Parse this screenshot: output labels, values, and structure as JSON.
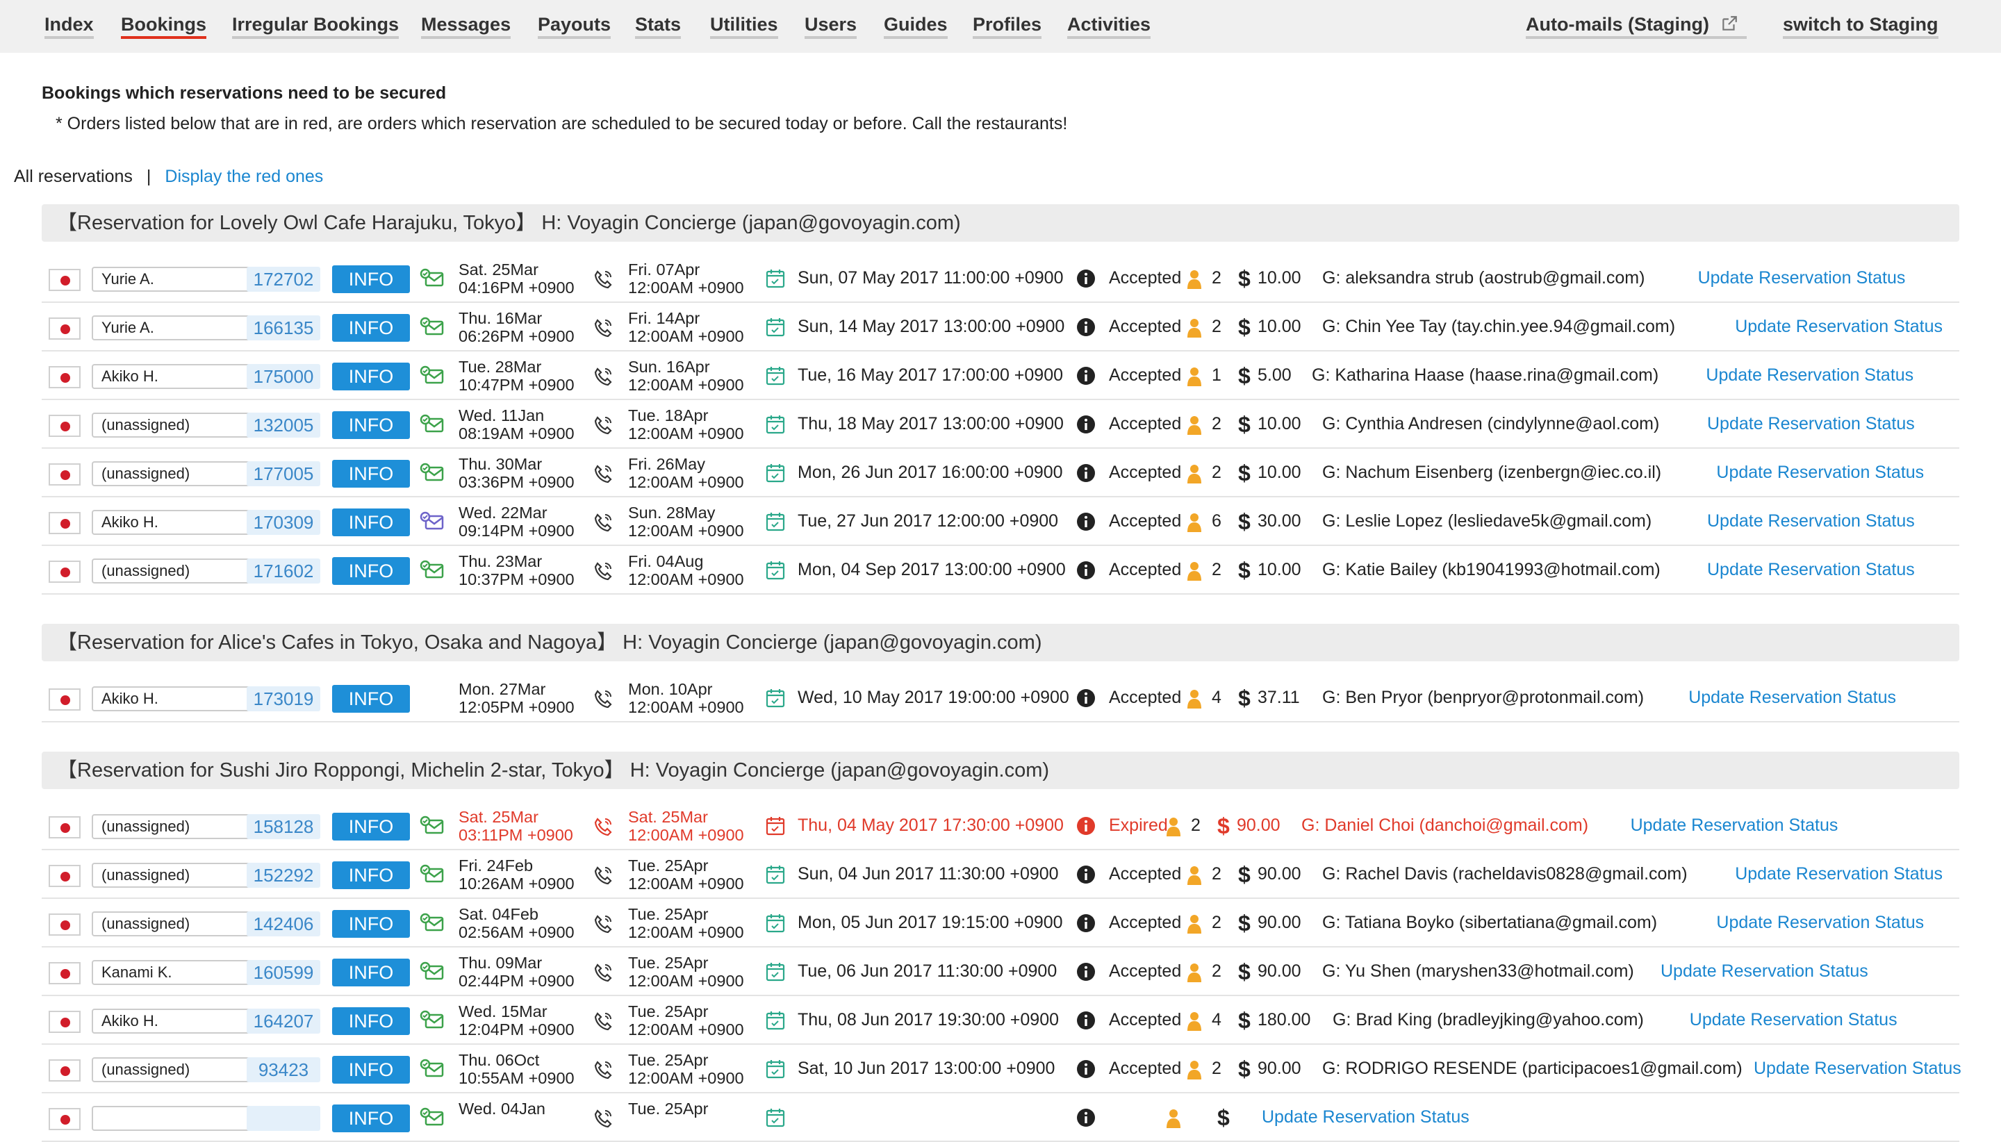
{
  "nav": {
    "items": [
      "Index",
      "Bookings",
      "Irregular Bookings",
      "Messages",
      "Payouts",
      "Stats",
      "Utilities",
      "Users",
      "Guides",
      "Profiles",
      "Activities"
    ],
    "active": "Bookings",
    "auto_mails": "Auto-mails (Staging)",
    "switch": "switch to Staging"
  },
  "page": {
    "title": "Bookings which reservations need to be secured",
    "note": "* Orders listed below that are in red, are orders which reservation are scheduled to be secured today or before. Call the restaurants!",
    "filter_all": "All reservations",
    "filter_sep": "|",
    "filter_red": "Display the red ones"
  },
  "icons": {
    "flag": "japan-flag-icon",
    "order": "order-email-icon",
    "phone": "phone-icon",
    "calendar": "calendar-icon",
    "info": "info-circle-icon",
    "person": "person-icon",
    "dollar": "dollar-icon",
    "external": "external-link-icon"
  },
  "colors": {
    "accent_link": "#1a86d0",
    "info_button": "#1e8fd8",
    "expired_red": "#e03a2a",
    "active_tab_underline": "#e0311d",
    "order_icon_green": "#3ca24a",
    "order_icon_purple": "#6d63c9",
    "person_orange": "#f2a627"
  },
  "labels": {
    "info": "INFO",
    "update": "Update Reservation Status",
    "dollar": "$"
  },
  "groups": [
    {
      "title": "【Reservation for Lovely Owl Cafe Harajuku, Tokyo】 H: Voyagin Concierge (japan@govoyagin.com)",
      "rows": [
        {
          "assignee": "Yurie A.",
          "id": "172702",
          "ordered_1": "Sat. 25Mar",
          "ordered_2": "04:16PM +0900",
          "secure_1": "Fri. 07Apr",
          "secure_2": "12:00AM +0900",
          "date": "Sun, 07 May 2017 11:00:00 +0900",
          "status": "Accepted",
          "pax": "2",
          "amount": "10.00",
          "guest": "G: aleksandra strub (aostrub@gmail.com)",
          "red": false,
          "order_icon": "green"
        },
        {
          "assignee": "Yurie A.",
          "id": "166135",
          "ordered_1": "Thu. 16Mar",
          "ordered_2": "06:26PM +0900",
          "secure_1": "Fri. 14Apr",
          "secure_2": "12:00AM +0900",
          "date": "Sun, 14 May 2017 13:00:00 +0900",
          "status": "Accepted",
          "pax": "2",
          "amount": "10.00",
          "guest": "G: Chin Yee Tay (tay.chin.yee.94@gmail.com)",
          "red": false,
          "order_icon": "green"
        },
        {
          "assignee": "Akiko H.",
          "id": "175000",
          "ordered_1": "Tue. 28Mar",
          "ordered_2": "10:47PM +0900",
          "secure_1": "Sun. 16Apr",
          "secure_2": "12:00AM +0900",
          "date": "Tue, 16 May 2017 17:00:00 +0900",
          "status": "Accepted",
          "pax": "1",
          "amount": "5.00",
          "guest": "G: Katharina Haase (haase.rina@gmail.com)",
          "red": false,
          "order_icon": "green"
        },
        {
          "assignee": "(unassigned)",
          "id": "132005",
          "ordered_1": "Wed. 11Jan",
          "ordered_2": "08:19AM +0900",
          "secure_1": "Tue. 18Apr",
          "secure_2": "12:00AM +0900",
          "date": "Thu, 18 May 2017 13:00:00 +0900",
          "status": "Accepted",
          "pax": "2",
          "amount": "10.00",
          "guest": "G: Cynthia Andresen (cindylynne@aol.com)",
          "red": false,
          "order_icon": "green"
        },
        {
          "assignee": "(unassigned)",
          "id": "177005",
          "ordered_1": "Thu. 30Mar",
          "ordered_2": "03:36PM +0900",
          "secure_1": "Fri. 26May",
          "secure_2": "12:00AM +0900",
          "date": "Mon, 26 Jun 2017 16:00:00 +0900",
          "status": "Accepted",
          "pax": "2",
          "amount": "10.00",
          "guest": "G: Nachum Eisenberg (izenbergn@iec.co.il)",
          "red": false,
          "order_icon": "green"
        },
        {
          "assignee": "Akiko H.",
          "id": "170309",
          "ordered_1": "Wed. 22Mar",
          "ordered_2": "09:14PM +0900",
          "secure_1": "Sun. 28May",
          "secure_2": "12:00AM +0900",
          "date": "Tue, 27 Jun 2017 12:00:00 +0900",
          "status": "Accepted",
          "pax": "6",
          "amount": "30.00",
          "guest": "G: Leslie Lopez (lesliedave5k@gmail.com)",
          "red": false,
          "order_icon": "purple"
        },
        {
          "assignee": "(unassigned)",
          "id": "171602",
          "ordered_1": "Thu. 23Mar",
          "ordered_2": "10:37PM +0900",
          "secure_1": "Fri. 04Aug",
          "secure_2": "12:00AM +0900",
          "date": "Mon, 04 Sep 2017 13:00:00 +0900",
          "status": "Accepted",
          "pax": "2",
          "amount": "10.00",
          "guest": "G: Katie Bailey (kb19041993@hotmail.com)",
          "red": false,
          "order_icon": "green"
        }
      ]
    },
    {
      "title": "【Reservation for Alice's Cafes in Tokyo, Osaka and Nagoya】 H: Voyagin Concierge (japan@govoyagin.com)",
      "rows": [
        {
          "assignee": "Akiko H.",
          "id": "173019",
          "ordered_1": "Mon. 27Mar",
          "ordered_2": "12:05PM +0900",
          "secure_1": "Mon. 10Apr",
          "secure_2": "12:00AM +0900",
          "date": "Wed, 10 May 2017 19:00:00 +0900",
          "status": "Accepted",
          "pax": "4",
          "amount": "37.11",
          "guest": "G: Ben Pryor (benpryor@protonmail.com)",
          "red": false,
          "order_icon": "none"
        }
      ]
    },
    {
      "title": "【Reservation for Sushi Jiro Roppongi, Michelin 2-star, Tokyo】 H: Voyagin Concierge (japan@govoyagin.com)",
      "rows": [
        {
          "assignee": "(unassigned)",
          "id": "158128",
          "ordered_1": "Sat. 25Mar",
          "ordered_2": "03:11PM +0900",
          "secure_1": "Sat. 25Mar",
          "secure_2": "12:00AM +0900",
          "date": "Thu, 04 May 2017 17:30:00 +0900",
          "status": "Expired",
          "pax": "2",
          "amount": "90.00",
          "guest": "G: Daniel Choi (danchoi@gmail.com)",
          "red": true,
          "order_icon": "green"
        },
        {
          "assignee": "(unassigned)",
          "id": "152292",
          "ordered_1": "Fri. 24Feb",
          "ordered_2": "10:26AM +0900",
          "secure_1": "Tue. 25Apr",
          "secure_2": "12:00AM +0900",
          "date": "Sun, 04 Jun 2017 11:30:00 +0900",
          "status": "Accepted",
          "pax": "2",
          "amount": "90.00",
          "guest": "G: Rachel Davis (racheldavis0828@gmail.com)",
          "red": false,
          "order_icon": "green"
        },
        {
          "assignee": "(unassigned)",
          "id": "142406",
          "ordered_1": "Sat. 04Feb",
          "ordered_2": "02:56AM +0900",
          "secure_1": "Tue. 25Apr",
          "secure_2": "12:00AM +0900",
          "date": "Mon, 05 Jun 2017 19:15:00 +0900",
          "status": "Accepted",
          "pax": "2",
          "amount": "90.00",
          "guest": "G: Tatiana Boyko (sibertatiana@gmail.com)",
          "red": false,
          "order_icon": "green"
        },
        {
          "assignee": "Kanami K.",
          "id": "160599",
          "ordered_1": "Thu. 09Mar",
          "ordered_2": "02:44PM +0900",
          "secure_1": "Tue. 25Apr",
          "secure_2": "12:00AM +0900",
          "date": "Tue, 06 Jun 2017 11:30:00 +0900",
          "status": "Accepted",
          "pax": "2",
          "amount": "90.00",
          "guest": "G: Yu Shen (maryshen33@hotmail.com)",
          "red": false,
          "order_icon": "green"
        },
        {
          "assignee": "Akiko H.",
          "id": "164207",
          "ordered_1": "Wed. 15Mar",
          "ordered_2": "12:04PM +0900",
          "secure_1": "Tue. 25Apr",
          "secure_2": "12:00AM +0900",
          "date": "Thu, 08 Jun 2017 19:30:00 +0900",
          "status": "Accepted",
          "pax": "4",
          "amount": "180.00",
          "guest": "G: Brad King (bradleyjking@yahoo.com)",
          "red": false,
          "order_icon": "green"
        },
        {
          "assignee": "(unassigned)",
          "id": "93423",
          "ordered_1": "Thu. 06Oct",
          "ordered_2": "10:55AM +0900",
          "secure_1": "Tue. 25Apr",
          "secure_2": "12:00AM +0900",
          "date": "Sat, 10 Jun 2017 13:00:00 +0900",
          "status": "Accepted",
          "pax": "2",
          "amount": "90.00",
          "guest": "G: RODRIGO RESENDE (participacoes1@gmail.com)",
          "red": false,
          "order_icon": "green"
        },
        {
          "assignee": "",
          "id": "",
          "ordered_1": "Wed. 04Jan",
          "ordered_2": "",
          "secure_1": "Tue. 25Apr",
          "secure_2": "",
          "date": "",
          "status": "",
          "pax": "",
          "amount": "",
          "guest": "",
          "red": false,
          "order_icon": "green"
        }
      ]
    }
  ]
}
